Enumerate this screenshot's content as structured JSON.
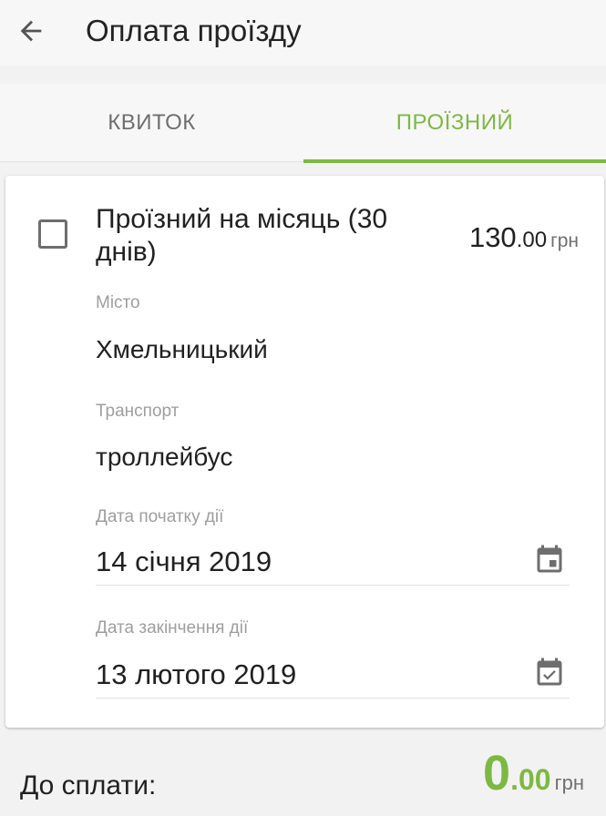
{
  "header": {
    "title": "Оплата проїзду"
  },
  "tabs": [
    {
      "label": "КВИТОК",
      "active": false
    },
    {
      "label": "ПРОЇЗНИЙ",
      "active": true
    }
  ],
  "pass": {
    "checked": false,
    "title": "Проїзний на місяць (30 днів)",
    "price_int": "130",
    "price_dec": ".00",
    "currency": "грн",
    "city_label": "Місто",
    "city_value": "Хмельницький",
    "transport_label": "Транспорт",
    "transport_value": "троллейбус",
    "start_label": "Дата початку дії",
    "start_value": "14 січня 2019",
    "end_label": "Дата закінчення дії",
    "end_value": "13 лютого 2019"
  },
  "footer": {
    "due_label": "До сплати:",
    "due_int": "0",
    "due_dec": ".00",
    "currency": "грн"
  },
  "colors": {
    "accent": "#7cb943",
    "text": "#212121",
    "muted": "#9e9e9e"
  },
  "icons": {
    "back": "arrow-left-icon",
    "start_calendar": "calendar-icon",
    "end_calendar": "calendar-check-icon"
  }
}
